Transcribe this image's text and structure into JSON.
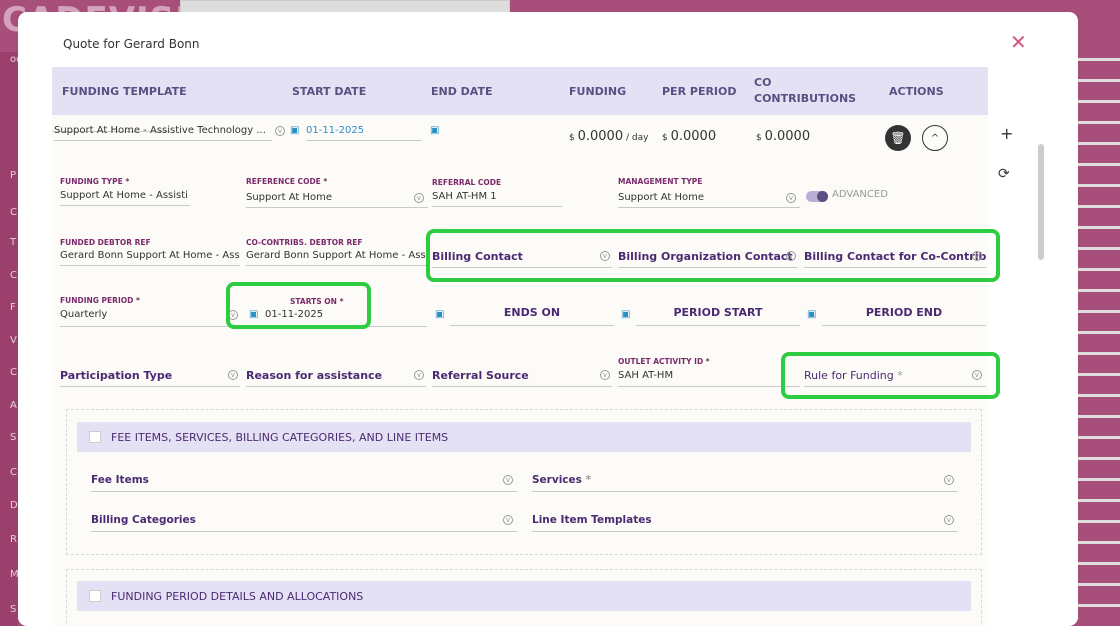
{
  "background": {
    "brand": "CADEVISION",
    "sidebar_letters": [
      "P",
      "C",
      "T",
      "C",
      "F",
      "V",
      "C",
      "A",
      "S",
      "C",
      "D",
      "R",
      "M",
      "S"
    ],
    "search_placeholder": "ook"
  },
  "modal": {
    "title": "Quote for Gerard Bonn",
    "close_icon": "close-icon"
  },
  "header": {
    "funding_template": "FUNDING TEMPLATE",
    "start_date": "START DATE",
    "end_date": "END DATE",
    "funding": "FUNDING",
    "per_period": "PER PERIOD",
    "co_contributions": "CO CONTRIBUTIONS",
    "actions": "ACTIONS"
  },
  "row": {
    "template": "Support At Home - Assistive Technology ...",
    "start_date": "01-11-2025",
    "end_date": "",
    "funding_currency": "$",
    "funding_value": "0.0000",
    "funding_unit": "/ day",
    "per_period_currency": "$",
    "per_period_value": "0.0000",
    "co_currency": "$",
    "co_value": "0.0000"
  },
  "fields": {
    "funding_type": {
      "label": "FUNDING TYPE *",
      "value": "Support At Home - Assisti"
    },
    "reference_code": {
      "label": "REFERENCE CODE *",
      "value": "Support At Home"
    },
    "referral_code": {
      "label": "REFERRAL CODE",
      "value": "SAH AT-HM 1"
    },
    "management_type": {
      "label": "MANAGEMENT TYPE",
      "value": "Support At Home"
    },
    "advanced_toggle": {
      "label": "ADVANCED"
    },
    "funded_debtor_ref": {
      "label": "FUNDED DEBTOR REF",
      "value": "Gerard Bonn Support At Home - Ass"
    },
    "co_contribs_debtor_ref": {
      "label": "CO-CONTRIBS. DEBTOR REF",
      "value": "Gerard Bonn Support At Home - Ass"
    },
    "billing_contact": {
      "label": "Billing Contact"
    },
    "billing_org_contact": {
      "label": "Billing Organization Contact"
    },
    "billing_contact_co": {
      "label": "Billing Contact for Co-Contribu..."
    },
    "funding_period": {
      "label": "FUNDING PERIOD *",
      "value": "Quarterly"
    },
    "starts_on": {
      "label": "STARTS ON *",
      "value": "01-11-2025"
    },
    "ends_on": {
      "label": "ENDS ON"
    },
    "period_start": {
      "label": "PERIOD START"
    },
    "period_end": {
      "label": "PERIOD END"
    },
    "participation_type": {
      "label": "Participation Type"
    },
    "reason": {
      "label": "Reason for assistance"
    },
    "referral_source": {
      "label": "Referral Source"
    },
    "outlet_activity": {
      "label": "OUTLET ACTIVITY ID *",
      "value": "SAH AT-HM"
    },
    "rule_for_funding": {
      "label": "Rule for Funding",
      "required": "*"
    }
  },
  "sections": [
    {
      "title": "FEE ITEMS, SERVICES, BILLING CATEGORIES, AND LINE ITEMS",
      "fields": {
        "fee_items": "Fee Items",
        "services": "Services",
        "services_required": "*",
        "billing_categories": "Billing Categories",
        "line_item_templates": "Line Item Templates"
      }
    },
    {
      "title": "FUNDING PERIOD DETAILS AND ALLOCATIONS"
    }
  ],
  "colors": {
    "accent": "#5a4f82",
    "highlight": "#2ecc40",
    "close": "#d2557e",
    "background": "#a84e7b"
  }
}
